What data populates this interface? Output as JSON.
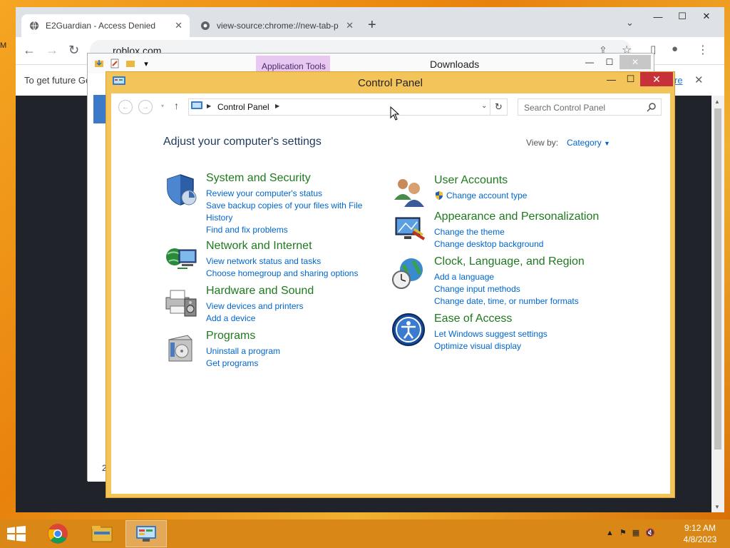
{
  "desktop": {
    "edge_text": "M"
  },
  "chrome": {
    "tabs": [
      {
        "label": "E2Guardian - Access Denied",
        "active": true
      },
      {
        "label": "view-source:chrome://new-tab-p",
        "active": false
      }
    ],
    "new_tab": "+",
    "url": "roblox.com",
    "infobar_text": "To get future Go",
    "infobar_link": "re"
  },
  "downloads": {
    "title": "Downloads",
    "app_tools": "Application Tools",
    "status": "2"
  },
  "control_panel": {
    "title": "Control Panel",
    "breadcrumb": "Control Panel",
    "search_placeholder": "Search Control Panel",
    "heading": "Adjust your computer's settings",
    "view_by_label": "View by:",
    "view_by_value": "Category",
    "left_categories": [
      {
        "title": "System and Security",
        "icon": "shield-icon",
        "links": [
          "Review your computer's status",
          "Save backup copies of your files with File History",
          "Find and fix problems"
        ]
      },
      {
        "title": "Network and Internet",
        "icon": "network-icon",
        "links": [
          "View network status and tasks",
          "Choose homegroup and sharing options"
        ]
      },
      {
        "title": "Hardware and Sound",
        "icon": "printer-icon",
        "links": [
          "View devices and printers",
          "Add a device"
        ]
      },
      {
        "title": "Programs",
        "icon": "programs-icon",
        "links": [
          "Uninstall a program",
          "Get programs"
        ]
      }
    ],
    "right_categories": [
      {
        "title": "User Accounts",
        "icon": "users-icon",
        "links": [
          "Change account type"
        ]
      },
      {
        "title": "Appearance and Personalization",
        "icon": "appearance-icon",
        "links": [
          "Change the theme",
          "Change desktop background"
        ]
      },
      {
        "title": "Clock, Language, and Region",
        "icon": "clock-globe-icon",
        "links": [
          "Add a language",
          "Change input methods",
          "Change date, time, or number formats"
        ]
      },
      {
        "title": "Ease of Access",
        "icon": "ease-of-access-icon",
        "links": [
          "Let Windows suggest settings",
          "Optimize visual display"
        ]
      }
    ]
  },
  "taskbar": {
    "time": "9:12 AM",
    "date": "4/8/2023"
  },
  "colors": {
    "accent_window": "#f3c45a",
    "link": "#0066cc",
    "category_title": "#1e7a1e",
    "heading": "#1e395b",
    "close_red": "#c7313a"
  }
}
